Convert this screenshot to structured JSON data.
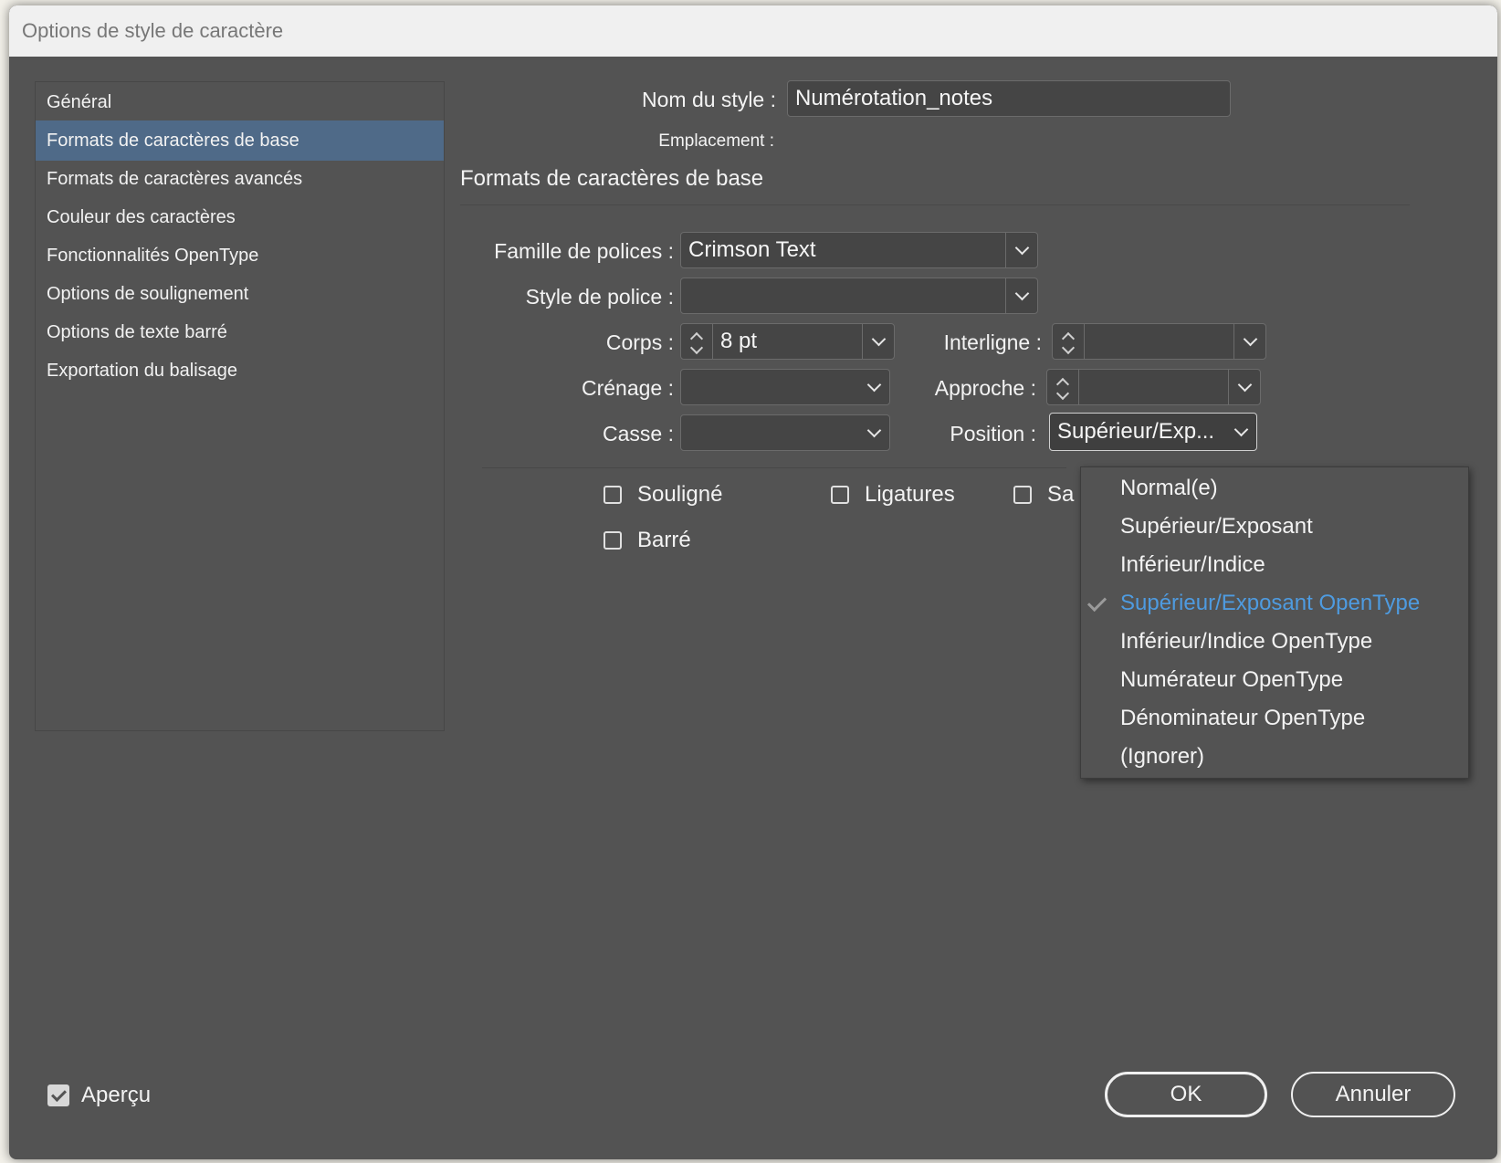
{
  "dialog": {
    "title": "Options de style de caractère"
  },
  "nav": {
    "items": [
      {
        "label": "Général"
      },
      {
        "label": "Formats de caractères de base",
        "selected": true
      },
      {
        "label": "Formats de caractères avancés"
      },
      {
        "label": "Couleur des caractères"
      },
      {
        "label": "Fonctionnalités OpenType"
      },
      {
        "label": "Options de soulignement"
      },
      {
        "label": "Options de texte barré"
      },
      {
        "label": "Exportation du balisage"
      }
    ]
  },
  "header": {
    "style_name_label": "Nom du style :",
    "style_name_value": "Numérotation_notes",
    "location_label": "Emplacement :",
    "section_title": "Formats de caractères de base"
  },
  "fields": {
    "font_family_label": "Famille de polices :",
    "font_family_value": "Crimson Text",
    "font_style_label": "Style de police :",
    "font_style_value": "",
    "size_label": "Corps :",
    "size_value": "8 pt",
    "leading_label": "Interligne :",
    "leading_value": "",
    "kerning_label": "Crénage :",
    "kerning_value": "",
    "tracking_label": "Approche :",
    "tracking_value": "",
    "case_label": "Casse :",
    "case_value": "",
    "position_label": "Position :",
    "position_value": "Supérieur/Exp..."
  },
  "checkboxes": {
    "underline": {
      "label": "Souligné",
      "checked": false
    },
    "ligatures": {
      "label": "Ligatures",
      "checked": false
    },
    "no_break": {
      "label": "Sa",
      "checked": false
    },
    "strikethrough": {
      "label": "Barré",
      "checked": false
    }
  },
  "position_menu": {
    "items": [
      {
        "label": "Normal(e)"
      },
      {
        "label": "Supérieur/Exposant"
      },
      {
        "label": "Inférieur/Indice"
      },
      {
        "label": "Supérieur/Exposant OpenType",
        "checked": true
      },
      {
        "label": "Inférieur/Indice OpenType"
      },
      {
        "label": "Numérateur OpenType"
      },
      {
        "label": "Dénominateur OpenType"
      },
      {
        "label": "(Ignorer)"
      }
    ]
  },
  "footer": {
    "preview_label": "Aperçu",
    "preview_checked": true,
    "ok_label": "OK",
    "cancel_label": "Annuler"
  },
  "colors": {
    "dialog_bg": "#535353",
    "selection_bg": "#4f6a88",
    "checked_item": "#4e9be0"
  }
}
